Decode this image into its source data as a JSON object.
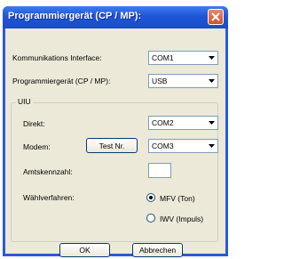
{
  "window": {
    "title": "Programmiergerät (CP / MP):"
  },
  "fields": {
    "interface_label": "Kommunikations Interface:",
    "interface_value": "COM1",
    "device_label": "Programmiergerät (CP / MP):",
    "device_value": "USB"
  },
  "uiu": {
    "group_label": "UIU",
    "direct_label": "Direkt:",
    "direct_value": "COM2",
    "modem_label": "Modem:",
    "test_button": "Test Nr.",
    "modem_value": "COM3",
    "prefix_label": "Amtskennzahl:",
    "prefix_value": "",
    "dial_label": "Wählverfahren:",
    "dial_options": [
      {
        "label": "MFV (Ton)",
        "selected": true
      },
      {
        "label": "IWV (Impuls)",
        "selected": false
      }
    ]
  },
  "buttons": {
    "ok": "OK",
    "cancel": "Abbrechen"
  },
  "icons": {
    "close": "close-x-icon",
    "dropdown": "chevron-down-icon",
    "radio_selected": "radio-dot-icon"
  },
  "colors": {
    "titlebar": "#1f55d6",
    "close_button": "#d4502a",
    "dialog_background": "#ece9d8",
    "input_border": "#7f9db9"
  }
}
